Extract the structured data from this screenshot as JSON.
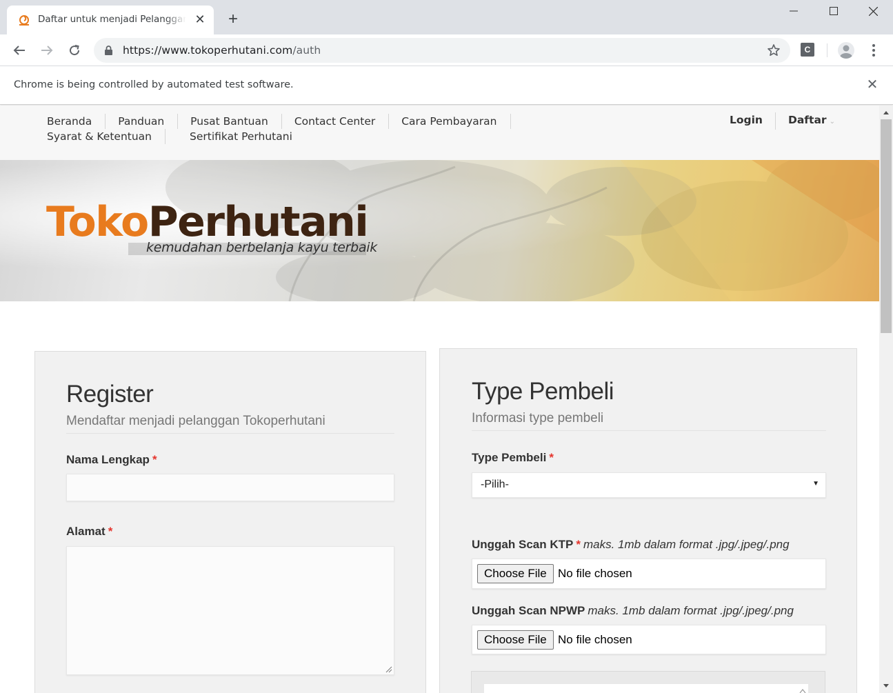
{
  "browser": {
    "tab_title": "Daftar untuk menjadi Pelanggan Tokoperhutani",
    "tab_close": "✕",
    "new_tab": "+",
    "url_main": "https://www.tokoperhutani.com",
    "url_path": "/auth",
    "extension_label": "C",
    "infobar_text": "Chrome is being controlled by automated test software.",
    "infobar_close": "✕"
  },
  "nav": {
    "links": [
      "Beranda",
      "Panduan",
      "Pusat Bantuan",
      "Contact Center",
      "Cara Pembayaran",
      "Syarat & Ketentuan",
      "Sertifikat Perhutani"
    ],
    "login": "Login",
    "daftar": "Daftar",
    "caret": "⌄"
  },
  "banner": {
    "logo_toko": "Toko",
    "logo_perhutani": "Perhutani",
    "tagline": "kemudahan berbelanja kayu terbaik"
  },
  "register": {
    "title": "Register",
    "subtitle": "Mendaftar menjadi pelanggan Tokoperhutani",
    "nama_label": "Nama Lengkap",
    "nama_value": "",
    "alamat_label": "Alamat",
    "alamat_value": "",
    "required_mark": "*"
  },
  "type_pembeli": {
    "title": "Type Pembeli",
    "subtitle": "Informasi type pembeli",
    "type_label": "Type Pembeli",
    "type_selected": "-Pilih-",
    "ktp_label": "Unggah Scan KTP",
    "ktp_hint": "maks. 1mb dalam format .jpg/.jpeg/.png",
    "npwp_label": "Unggah Scan NPWP",
    "npwp_hint": "maks. 1mb dalam format .jpg/.jpeg/.png",
    "choose_file": "Choose File",
    "no_file": "No file chosen",
    "select_arrow": "▼"
  },
  "colors": {
    "brand_orange": "#e87b1e",
    "brand_brown": "#3e2412",
    "required_red": "#e5352d"
  }
}
